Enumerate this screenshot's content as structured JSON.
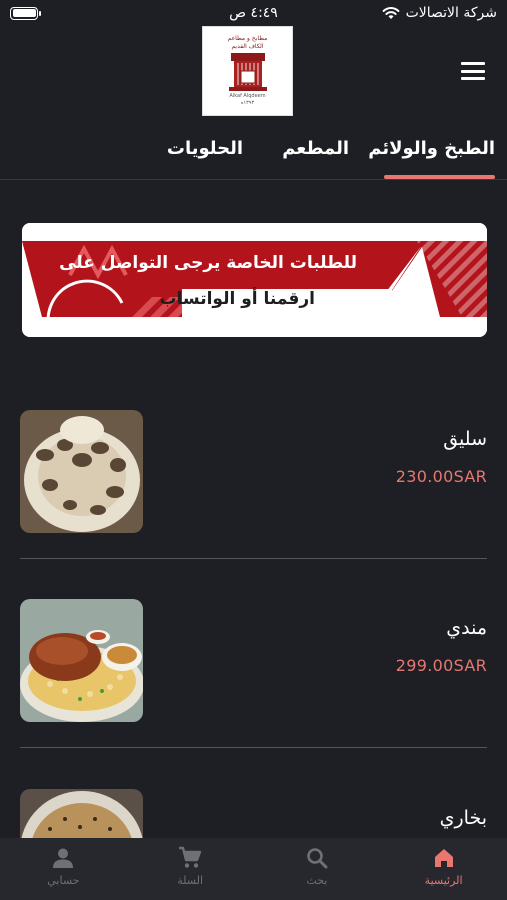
{
  "status_bar": {
    "carrier": "شركة الاتصالات",
    "time": "٤:٤٩ ص"
  },
  "header": {
    "logo": {
      "line1": "مطابخ و مطاعم",
      "line2": "الكاف القديم",
      "line3": "Alkaf Alqdeem",
      "line4": "١٣٩٣ه"
    },
    "menu_icon": "menu-icon"
  },
  "tabs": [
    {
      "label": "الطبخ والولائم",
      "active": true
    },
    {
      "label": "المطعم",
      "active": false
    },
    {
      "label": "الحلويات",
      "active": false
    }
  ],
  "banner": {
    "line1": "للطلبات الخاصة يرجى التواصل على",
    "line2": "ارقمنا أو الواتساب",
    "color": "#b3131b"
  },
  "products": [
    {
      "name": "سليق",
      "price": "230.00SAR"
    },
    {
      "name": "مندي",
      "price": "299.00SAR"
    },
    {
      "name": "بخاري",
      "price": ""
    }
  ],
  "bottom_nav": [
    {
      "label": "الرئيسية",
      "icon": "home-icon",
      "active": true
    },
    {
      "label": "بحث",
      "icon": "search-icon",
      "active": false
    },
    {
      "label": "السلة",
      "icon": "cart-icon",
      "active": false
    },
    {
      "label": "حسابي",
      "icon": "user-icon",
      "active": false
    }
  ],
  "colors": {
    "accent": "#e8776f",
    "background": "#1e1f24",
    "nav_background": "#27282d"
  }
}
